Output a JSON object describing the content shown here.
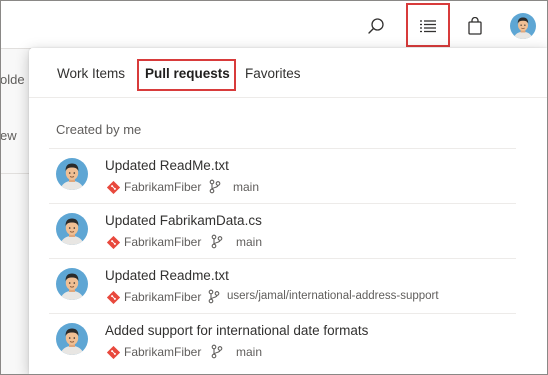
{
  "background": {
    "fragments": [
      "olde",
      "ew"
    ]
  },
  "header": {
    "icons": [
      "search-icon",
      "work-list-icon",
      "shopping-bag-icon",
      "user-avatar"
    ]
  },
  "panel": {
    "tabs": [
      {
        "label": "Work Items",
        "active": false
      },
      {
        "label": "Pull requests",
        "active": true
      },
      {
        "label": "Favorites",
        "active": false
      }
    ],
    "section_title": "Created by me",
    "pull_requests": [
      {
        "title": "Updated ReadMe.txt",
        "repo": "FabrikamFiber",
        "branch": "main"
      },
      {
        "title": "Updated FabrikamData.cs",
        "repo": "FabrikamFiber",
        "branch": "main"
      },
      {
        "title": "Updated Readme.txt",
        "repo": "FabrikamFiber",
        "branch": "users/jamal/international-address-support"
      },
      {
        "title": "Added support for international date formats",
        "repo": "FabrikamFiber",
        "branch": "main"
      }
    ]
  },
  "colors": {
    "highlight": "#d83b3b",
    "repo_icon": "#e8493d",
    "avatar_bg": "#5ea6d4"
  }
}
